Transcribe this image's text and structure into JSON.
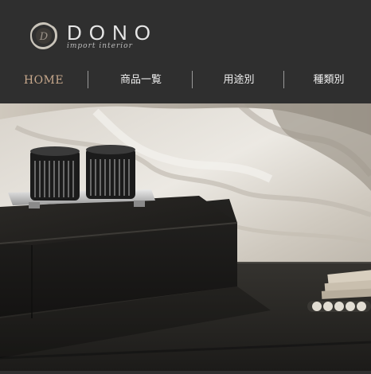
{
  "brand": {
    "name": "DONO",
    "tagline": "import interior"
  },
  "nav": {
    "items": [
      {
        "label": "HOME",
        "active": true
      },
      {
        "label": "商品一覧",
        "active": false
      },
      {
        "label": "用途別",
        "active": false
      },
      {
        "label": "種類別",
        "active": false
      }
    ]
  },
  "colors": {
    "header_bg": "#2f2f2f",
    "nav_active": "#c7a88c",
    "nav_text": "#f0f0f0"
  },
  "hero": {
    "image": "interior-photo-black-box-with-glass-candle-holders"
  }
}
